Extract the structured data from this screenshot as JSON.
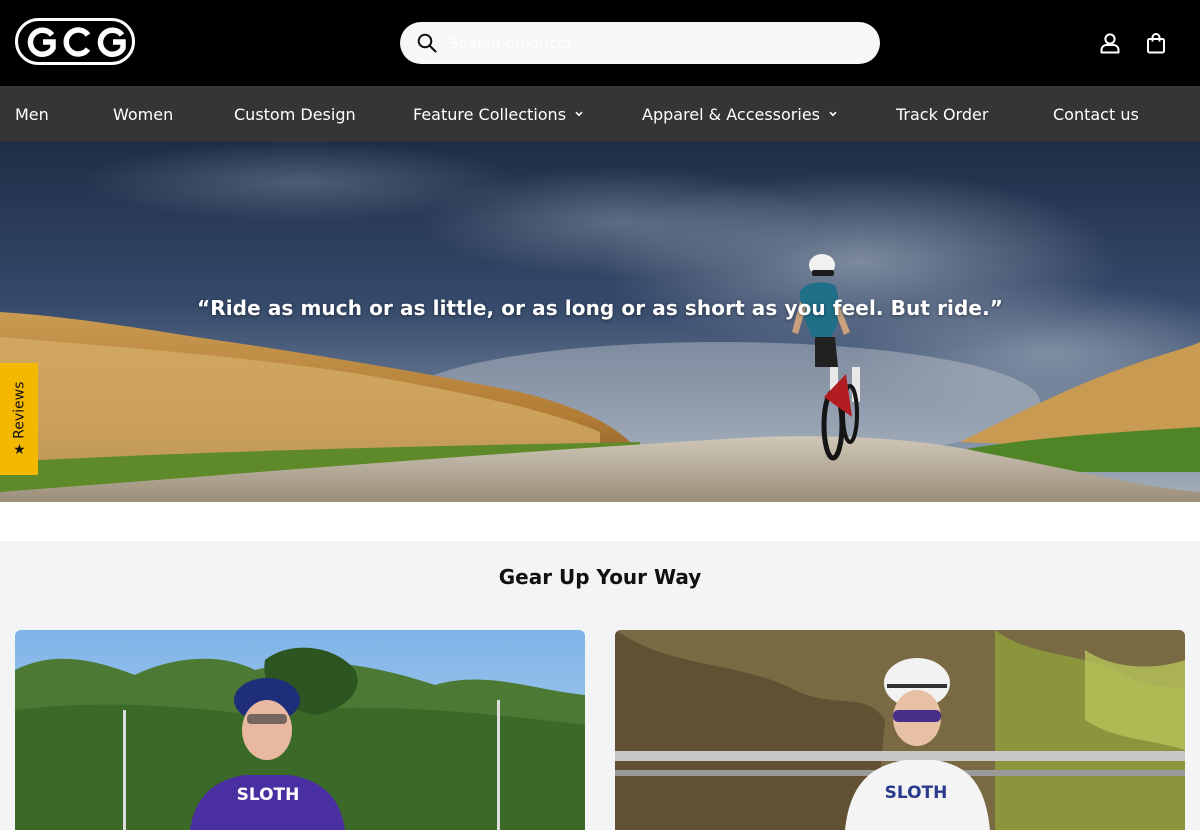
{
  "header": {
    "logo_text": "GCG",
    "search": {
      "placeholder": "Search products",
      "value": ""
    }
  },
  "nav": {
    "items": [
      {
        "label": "Men",
        "dropdown": false
      },
      {
        "label": "Women",
        "dropdown": false
      },
      {
        "label": "Custom Design",
        "dropdown": false
      },
      {
        "label": "Feature Collections",
        "dropdown": true
      },
      {
        "label": "Apparel & Accessories",
        "dropdown": true
      },
      {
        "label": "Track Order",
        "dropdown": false
      },
      {
        "label": "Contact us",
        "dropdown": false
      }
    ]
  },
  "hero": {
    "quote": "“Ride as much or as little, or as long or as short as you feel. But ride.”"
  },
  "reviews_tab": {
    "star": "★",
    "label": "Reviews"
  },
  "section": {
    "title": "Gear Up Your Way",
    "cards": [
      {
        "jersey_text": "SLOTH"
      },
      {
        "jersey_text": "SLOTH"
      }
    ]
  },
  "icons": {
    "search": "search-icon",
    "account": "user-icon",
    "cart": "shopping-bag-icon",
    "chevron": "chevron-down-icon",
    "star": "star-icon"
  },
  "colors": {
    "header_bg": "#000000",
    "nav_bg": "#353535",
    "reviews_tab": "#f5b800",
    "section_bg": "#f3f4f6"
  }
}
